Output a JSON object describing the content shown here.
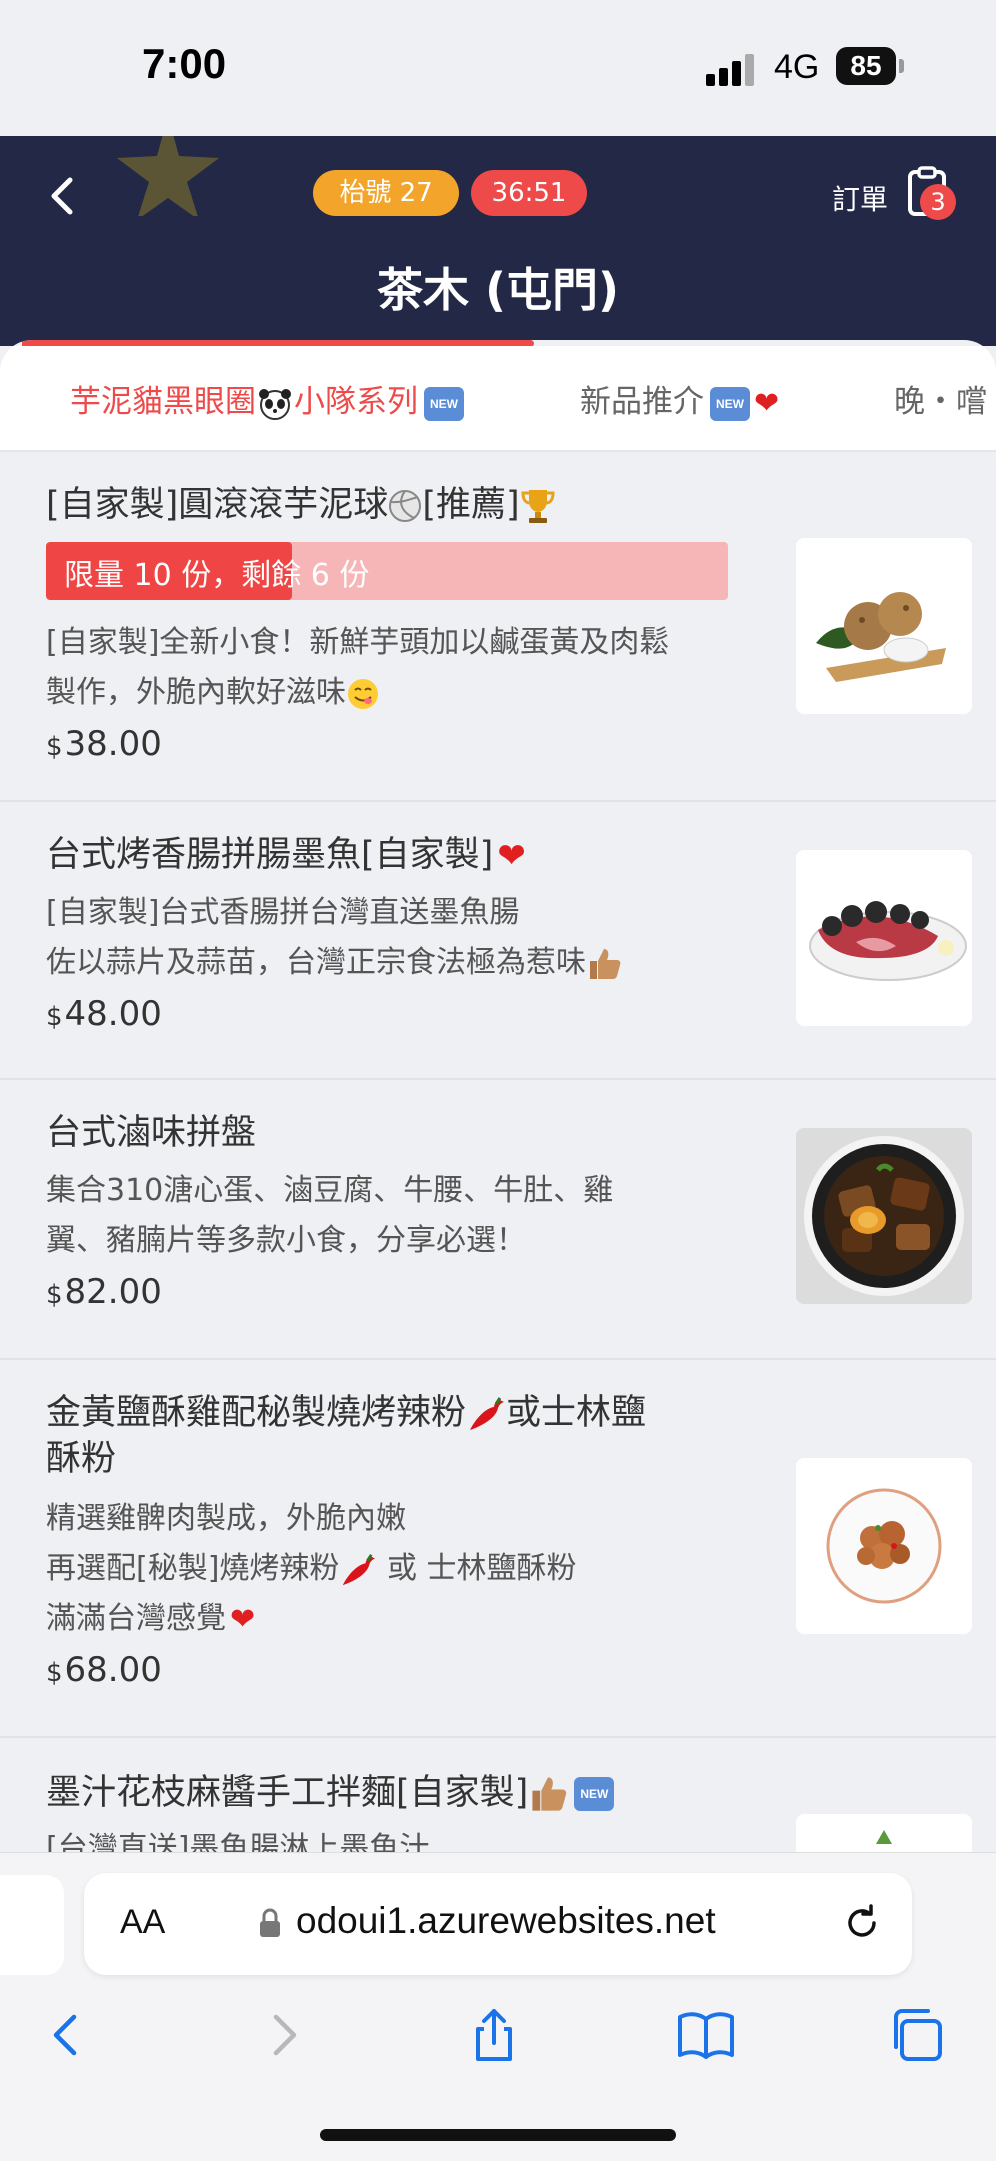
{
  "status_bar": {
    "time": "7:00",
    "network": "4G",
    "battery": "85"
  },
  "header": {
    "table_label": "枱號 27",
    "timer": "36:51",
    "order_label": "訂單",
    "order_count": "3",
    "store_name": "茶木 (屯門)"
  },
  "tabs": [
    {
      "label_a": "芋泥貓黑眼圈",
      "label_b": "小隊系列",
      "new_badge": "NEW"
    },
    {
      "label": "新品推介",
      "new_badge": "NEW"
    },
    {
      "label": "晚・嚐"
    }
  ],
  "items": [
    {
      "name": "[自家製]圓滾滾芋泥球",
      "name_suffix": "[推薦]",
      "limit_text": "限量 10 份，剩餘 6 份",
      "limit_remaining_fraction": 0.36,
      "desc_1": "[自家製]全新小食！新鮮芋頭加以鹹蛋黃及肉鬆",
      "desc_2": "製作，外脆內軟好滋味",
      "currency": "$",
      "price": "38.00"
    },
    {
      "name": "台式烤香腸拼腸墨魚[自家製]",
      "desc_1": "[自家製]台式香腸拼台灣直送墨魚腸",
      "desc_2": "佐以蒜片及蒜苗，台灣正宗食法極為惹味",
      "currency": "$",
      "price": "48.00"
    },
    {
      "name": "台式滷味拼盤",
      "desc_1": "集合310溏心蛋、滷豆腐、牛腰、牛肚、雞",
      "desc_2": "翼、豬腩片等多款小食，分享必選！",
      "currency": "$",
      "price": "82.00"
    },
    {
      "name_1": "金黃鹽酥雞配秘製燒烤辣粉",
      "name_1b": "或士林鹽",
      "name_2": "酥粉",
      "desc_1": "精選雞髀肉製成，外脆內嫩",
      "desc_2a": "再選配[秘製]燒烤辣粉",
      "desc_2b": " 或 士林鹽酥粉",
      "desc_3": "滿滿台灣感覺",
      "currency": "$",
      "price": "68.00"
    },
    {
      "name": "墨汁花枝麻醬手工拌麵[自家製]",
      "new_badge": "NEW",
      "desc_1": "[台灣直送]墨魚腸淋上墨魚汁"
    }
  ],
  "browser": {
    "aa": "AA",
    "url": "odoui1.azurewebsites.net"
  },
  "colors": {
    "header_bg": "#232846",
    "accent_red": "#ef4a4a",
    "table_pill": "#f3a52b"
  }
}
